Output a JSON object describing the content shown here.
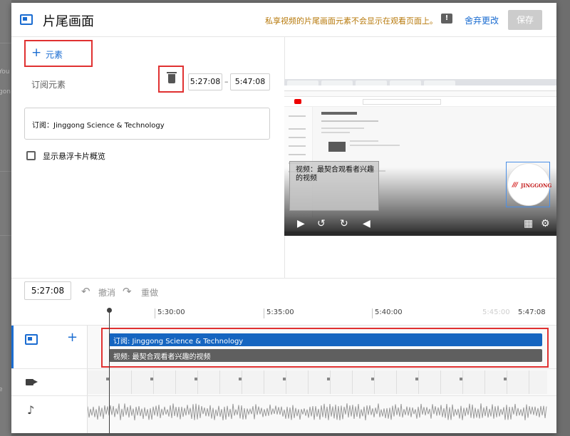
{
  "background": {
    "left_texts": [
      "You t",
      "gon",
      "e"
    ]
  },
  "header": {
    "title": "片尾画面",
    "notice": "私享视频的片尾画面元素不会显示在观看页面上。",
    "feedback_icon": "feedback-icon",
    "discard_label": "舍弃更改",
    "save_label": "保存"
  },
  "editor": {
    "add_element_label": "元素",
    "element_type_label": "订阅元素",
    "start_time": "5:27:08",
    "end_time": "5:47:08",
    "time_separator": "–",
    "element_text": "订阅：Jinggong Science & Technology",
    "checkbox_label": "显示悬浮卡片概览",
    "checkbox_checked": false
  },
  "preview": {
    "video_element_text": "视频：最契合观看者兴趣的视频",
    "channel_logo_text": "JINGGONG",
    "channel_logo_mark": "///"
  },
  "timeline": {
    "current_time": "5:27:08",
    "undo_label": "撤消",
    "redo_label": "重做",
    "ruler_labels": [
      "5:30:00",
      "5:35:00",
      "5:40:00",
      "5:45:00",
      "5:47:08"
    ],
    "elements": [
      {
        "label": "订阅: Jinggong Science & Technology",
        "color": "#1565c0"
      },
      {
        "label": "视频: 最契合观看者兴趣的视频",
        "color": "#5f5f5f"
      }
    ]
  },
  "colors": {
    "accent": "#1a6cd1",
    "highlight_box": "#e03131",
    "notice": "#b7790b"
  }
}
